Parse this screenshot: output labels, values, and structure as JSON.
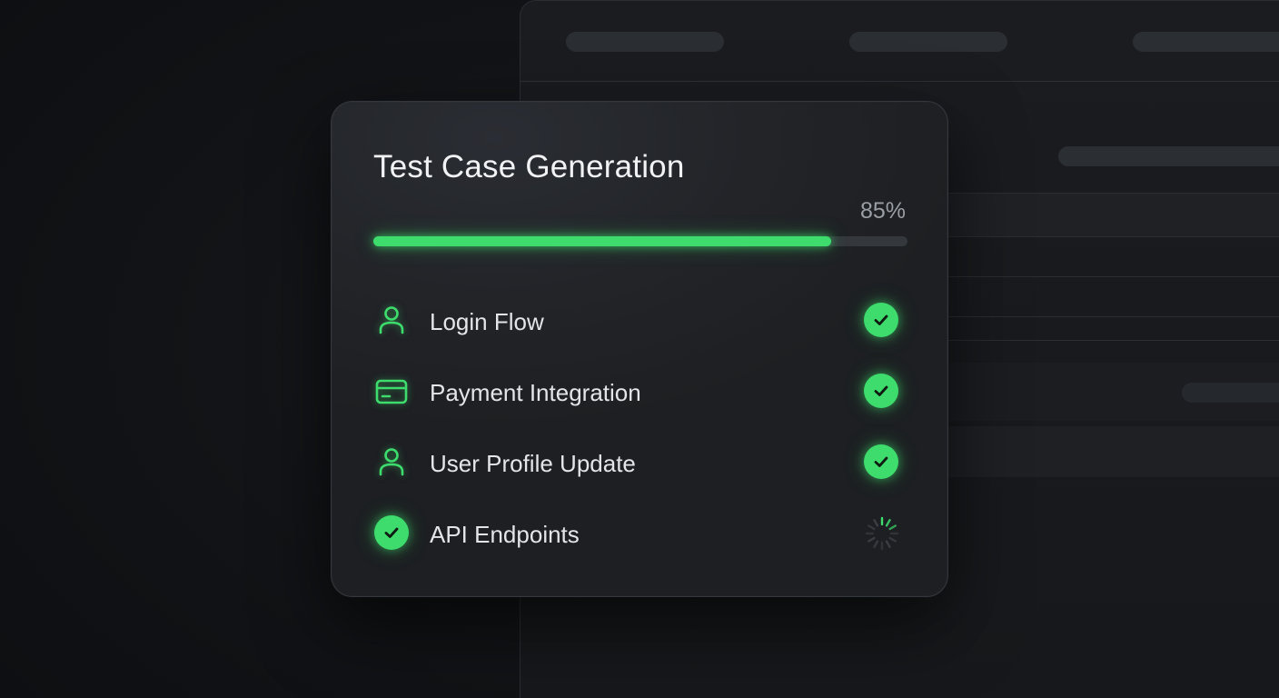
{
  "colors": {
    "accent": "#3ddc6c",
    "background": "#101215",
    "card": "#222428",
    "text": "#e3e5e8"
  },
  "card": {
    "title": "Test Case Generation",
    "progress": {
      "percent_label": "85%",
      "fraction": 0.857
    },
    "items": [
      {
        "label": "Login Flow",
        "icon": "user-icon",
        "status": "complete"
      },
      {
        "label": "Payment Integration",
        "icon": "credit-card-icon",
        "status": "complete"
      },
      {
        "label": "User Profile Update",
        "icon": "user-icon",
        "status": "complete"
      },
      {
        "label": "API Endpoints",
        "icon": "check-circle-icon",
        "status": "in-progress"
      }
    ]
  }
}
